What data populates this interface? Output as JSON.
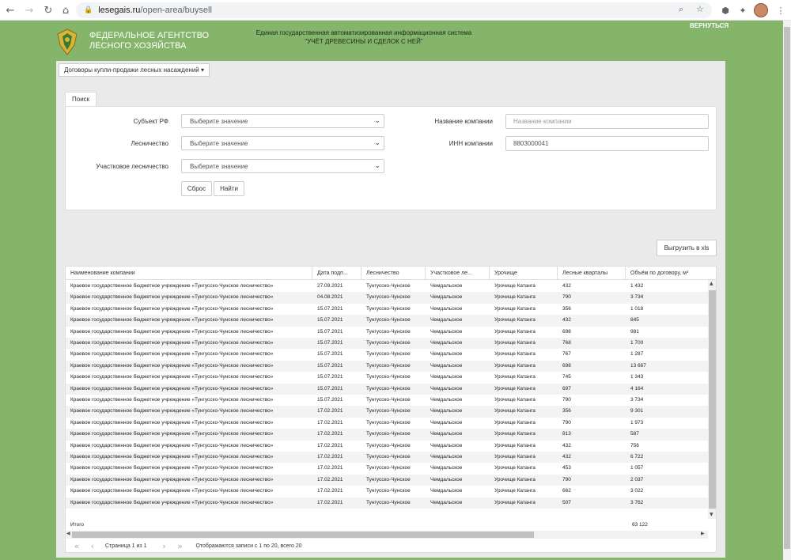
{
  "browser": {
    "url_host": "lesegais.ru",
    "url_path": "/open-area/buysell"
  },
  "header": {
    "agency_line1": "ФЕДЕРАЛЬНОЕ АГЕНТСТВО",
    "agency_line2": "ЛЕСНОГО ХОЗЯЙСТВА",
    "system_line1": "Единая государственная автоматизированная информационная система",
    "system_line2": "\"УЧЁТ ДРЕВЕСИНЫ И СДЕЛОК С НЕЙ\"",
    "back_link": "ВЕРНУТЬСЯ"
  },
  "menu": {
    "dropdown_label": "Договоры купли-продажи лесных насаждений ▾"
  },
  "search": {
    "tab_label": "Поиск",
    "subject_label": "Субъект РФ",
    "subject_value": "Выберите значение",
    "forestry_label": "Лесничество",
    "forestry_value": "Выберите значение",
    "district_label": "Участковое лесничество",
    "district_value": "Выберите значение",
    "company_name_label": "Название компании",
    "company_name_placeholder": "Название компании",
    "inn_label": "ИНН компании",
    "inn_value": "8803000041",
    "reset_button": "Сброс",
    "find_button": "Найти"
  },
  "export_button": "Выгрузить в xls",
  "table": {
    "columns": [
      "Наименование компании",
      "Дата подп...",
      "Лесничество",
      "Участковое ле...",
      "Урочище",
      "Лесные кварталы",
      "Объём по договору, м³"
    ],
    "rows": [
      [
        "Краевое государственное бюджетное учреждение «Тунгусско-Чунское лесничество»",
        "27.09.2021",
        "Тунгусско-Чунское",
        "Чемдальское",
        "Урочище Катанга",
        "432",
        "1 432"
      ],
      [
        "Краевое государственное бюджетное учреждение «Тунгусско-Чунское лесничество»",
        "04.08.2021",
        "Тунгусско-Чунское",
        "Чемдальское",
        "Урочище Катанга",
        "790",
        "3 734"
      ],
      [
        "Краевое государственное бюджетное учреждение «Тунгусско-Чунское лесничество»",
        "15.07.2021",
        "Тунгусско-Чунское",
        "Чемдальское",
        "Урочище Катанга",
        "356",
        "1 018"
      ],
      [
        "Краевое государственное бюджетное учреждение «Тунгусско-Чунское лесничество»",
        "15.07.2021",
        "Тунгусско-Чунское",
        "Чемдальское",
        "Урочище Катанга",
        "432",
        "845"
      ],
      [
        "Краевое государственное бюджетное учреждение «Тунгусско-Чунское лесничество»",
        "15.07.2021",
        "Тунгусско-Чунское",
        "Чемдальское",
        "Урочище Катанга",
        "698",
        "981"
      ],
      [
        "Краевое государственное бюджетное учреждение «Тунгусско-Чунское лесничество»",
        "15.07.2021",
        "Тунгусско-Чунское",
        "Чемдальское",
        "Урочище Катанга",
        "768",
        "1 700"
      ],
      [
        "Краевое государственное бюджетное учреждение «Тунгусско-Чунское лесничество»",
        "15.07.2021",
        "Тунгусско-Чунское",
        "Чемдальское",
        "Урочище Катанга",
        "767",
        "1 287"
      ],
      [
        "Краевое государственное бюджетное учреждение «Тунгусско-Чунское лесничество»",
        "15.07.2021",
        "Тунгусско-Чунское",
        "Чемдальское",
        "Урочище Катанга",
        "698",
        "13 667"
      ],
      [
        "Краевое государственное бюджетное учреждение «Тунгусско-Чунское лесничество»",
        "15.07.2021",
        "Тунгусско-Чунское",
        "Чемдальское",
        "Урочище Катанга",
        "745",
        "1 343"
      ],
      [
        "Краевое государственное бюджетное учреждение «Тунгусско-Чунское лесничество»",
        "15.07.2021",
        "Тунгусско-Чунское",
        "Чемдальское",
        "Урочище Катанга",
        "697",
        "4 164"
      ],
      [
        "Краевое государственное бюджетное учреждение «Тунгусско-Чунское лесничество»",
        "15.07.2021",
        "Тунгусско-Чунское",
        "Чемдальское",
        "Урочище Катанга",
        "790",
        "3 734"
      ],
      [
        "Краевое государственное бюджетное учреждение «Тунгусско-Чунское лесничество»",
        "17.02.2021",
        "Тунгусско-Чунское",
        "Чемдальское",
        "Урочище Катанга",
        "356",
        "9 301"
      ],
      [
        "Краевое государственное бюджетное учреждение «Тунгусско-Чунское лесничество»",
        "17.02.2021",
        "Тунгусско-Чунское",
        "Чемдальское",
        "Урочище Катанга",
        "790",
        "1 973"
      ],
      [
        "Краевое государственное бюджетное учреждение «Тунгусско-Чунское лесничество»",
        "17.02.2021",
        "Тунгусско-Чунское",
        "Чемдальское",
        "Урочище Катанга",
        "813",
        "587"
      ],
      [
        "Краевое государственное бюджетное учреждение «Тунгусско-Чунское лесничество»",
        "17.02.2021",
        "Тунгусско-Чунское",
        "Чемдальское",
        "Урочище Катанга",
        "432",
        "756"
      ],
      [
        "Краевое государственное бюджетное учреждение «Тунгусско-Чунское лесничество»",
        "17.02.2021",
        "Тунгусско-Чунское",
        "Чемдальское",
        "Урочище Катанга",
        "432",
        "6 722"
      ],
      [
        "Краевое государственное бюджетное учреждение «Тунгусско-Чунское лесничество»",
        "17.02.2021",
        "Тунгусско-Чунское",
        "Чемдальское",
        "Урочище Катанга",
        "453",
        "1 057"
      ],
      [
        "Краевое государственное бюджетное учреждение «Тунгусско-Чунское лесничество»",
        "17.02.2021",
        "Тунгусско-Чунское",
        "Чемдальское",
        "Урочище Катанга",
        "790",
        "2 037"
      ],
      [
        "Краевое государственное бюджетное учреждение «Тунгусско-Чунское лесничество»",
        "17.02.2021",
        "Тунгусско-Чунское",
        "Чемдальское",
        "Урочище Катанга",
        "662",
        "3 022"
      ],
      [
        "Краевое государственное бюджетное учреждение «Тунгусско-Чунское лесничество»",
        "17.02.2021",
        "Тунгусско-Чунское",
        "Чемдальское",
        "Урочище Катанга",
        "507",
        "3 762"
      ]
    ],
    "total_label": "Итого",
    "total_value": "63 122"
  },
  "pager": {
    "page_info": "Страница 1 из 1",
    "records_info": "Отображаются записи с 1 по 20, всего 20"
  },
  "colors": {
    "page_background": "#84b56b",
    "card_background": "#eaeaea"
  }
}
